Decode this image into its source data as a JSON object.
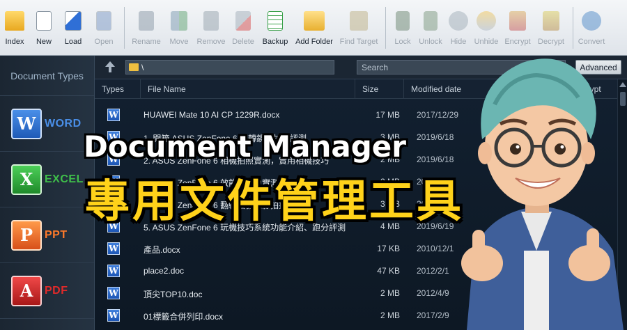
{
  "toolbar": {
    "buttons": [
      {
        "label": "Index",
        "icon": "index-folder-icon",
        "enabled": true
      },
      {
        "label": "New",
        "icon": "new-document-icon",
        "enabled": true
      },
      {
        "label": "Load",
        "icon": "load-icon",
        "enabled": true
      },
      {
        "label": "Open",
        "icon": "open-word-icon",
        "enabled": false
      },
      {
        "label": "Rename",
        "icon": "rename-icon",
        "enabled": false
      },
      {
        "label": "Move",
        "icon": "move-icon",
        "enabled": false
      },
      {
        "label": "Remove",
        "icon": "remove-icon",
        "enabled": false
      },
      {
        "label": "Delete",
        "icon": "delete-icon",
        "enabled": false
      },
      {
        "label": "Backup",
        "icon": "backup-icon",
        "enabled": true
      },
      {
        "label": "Add Folder",
        "icon": "add-folder-icon",
        "enabled": true
      },
      {
        "label": "Find Target",
        "icon": "find-target-icon",
        "enabled": false
      },
      {
        "label": "Lock",
        "icon": "lock-icon",
        "enabled": false
      },
      {
        "label": "Unlock",
        "icon": "unlock-icon",
        "enabled": false
      },
      {
        "label": "Hide",
        "icon": "hide-icon",
        "enabled": false
      },
      {
        "label": "Unhide",
        "icon": "unhide-icon",
        "enabled": false
      },
      {
        "label": "Encrypt",
        "icon": "encrypt-icon",
        "enabled": false
      },
      {
        "label": "Decrypt",
        "icon": "decrypt-icon",
        "enabled": false
      },
      {
        "label": "Convert",
        "icon": "convert-icon",
        "enabled": false
      }
    ]
  },
  "sidebar": {
    "title": "Document Types",
    "items": [
      {
        "label": "WORD",
        "glyph": "W",
        "color": "#4a8fe8"
      },
      {
        "label": "EXCEL",
        "glyph": "X",
        "color": "#3fbf4a"
      },
      {
        "label": "PPT",
        "glyph": "P",
        "color": "#ff7a2a"
      },
      {
        "label": "PDF",
        "glyph": "A",
        "color": "#e02a2a"
      }
    ]
  },
  "pathbar": {
    "path": "\\",
    "search_placeholder": "Search",
    "advanced_label": "Advanced"
  },
  "columns": {
    "types": "Types",
    "file_name": "File Name",
    "size": "Size",
    "modified": "Modified date",
    "encrypt": "Encrypt"
  },
  "files": [
    {
      "name": "HUAWEI Mate 10  AI  CP  1229R.docx",
      "size": "17 MB",
      "date": "2017/12/29"
    },
    {
      "name": "1. 開箱  ASUS ZenFone 6 翻轉鏡頭拍照評測",
      "size": "3 MB",
      "date": "2019/6/18"
    },
    {
      "name": "2. ASUS ZenFone 6 相機拍照實測，實用相機技巧",
      "size": "2 MB",
      "date": "2019/6/18"
    },
    {
      "name": "3. ASUS ZenFone 6 效能與電力實測",
      "size": "2 MB",
      "date": "2019/6/18"
    },
    {
      "name": "4. ASUS ZenFone 6 翻轉相機錄影拍攝",
      "size": "3 MB",
      "date": "2019/6/18"
    },
    {
      "name": "5. ASUS ZenFone 6 玩機技巧系統功能介紹、跑分評測",
      "size": "4 MB",
      "date": "2019/6/19"
    },
    {
      "name": "產品.docx",
      "size": "17 KB",
      "date": "2010/12/1"
    },
    {
      "name": "place2.doc",
      "size": "47 KB",
      "date": "2012/2/1"
    },
    {
      "name": "頂尖TOP10.doc",
      "size": "2 MB",
      "date": "2012/4/9"
    },
    {
      "name": "01標籤合併列印.docx",
      "size": "2 MB",
      "date": "2017/2/9"
    }
  ],
  "banner": {
    "title_en": "Document Manager",
    "title_zh": "專用文件管理工具"
  }
}
